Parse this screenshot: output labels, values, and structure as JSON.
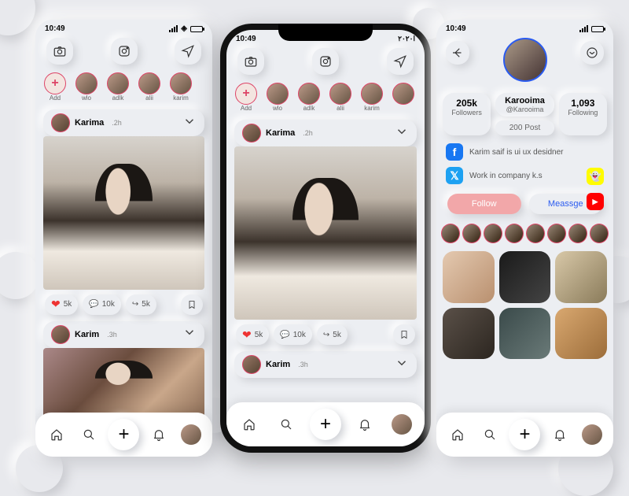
{
  "time": "10:49",
  "arabic_time": "ا٢٠٢٠",
  "stories": {
    "items": [
      {
        "label": "Add",
        "add": true
      },
      {
        "label": "wlo"
      },
      {
        "label": "adlk"
      },
      {
        "label": "alii"
      },
      {
        "label": "karim"
      }
    ]
  },
  "feed": {
    "posts": [
      {
        "author": "Karima",
        "time": ".2h",
        "likes": "5k",
        "comments": "10k",
        "shares": "5k"
      },
      {
        "author": "Karim",
        "time": ".3h"
      }
    ]
  },
  "profile": {
    "name": "Karooima",
    "handle": "@Karooima",
    "followers": {
      "count": "205k",
      "label": "Followers"
    },
    "following": {
      "count": "1,093",
      "label": "Following"
    },
    "posts_label": "200 Post",
    "bio_line1": "Karim saif is ui ux desidner",
    "bio_line2": "Work in company k.s",
    "follow_label": "Follow",
    "message_label": "Meassge"
  }
}
